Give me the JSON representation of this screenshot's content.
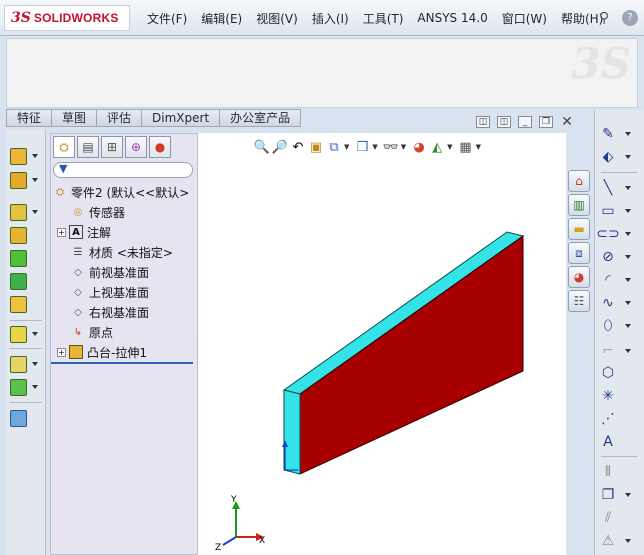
{
  "app": {
    "logo_prefix": "3S",
    "logo_text": "SOLIDWORKS"
  },
  "menu": {
    "items": [
      "文件(F)",
      "编辑(E)",
      "视图(V)",
      "插入(I)",
      "工具(T)",
      "ANSYS 14.0",
      "窗口(W)",
      "帮助(H)"
    ]
  },
  "command_manager": {
    "tabs": [
      "特征",
      "草图",
      "评估",
      "DimXpert",
      "办公室产品"
    ],
    "watermark": "3S"
  },
  "feature_tree": {
    "filter_icon": "filter-icon",
    "part": "零件2  (默认<<默认>",
    "items": [
      {
        "label": "传感器",
        "icon": "sensor-icon"
      },
      {
        "label": "注解",
        "icon": "annotation-icon",
        "expandable": true
      },
      {
        "label": "材质 <未指定>",
        "icon": "material-icon"
      },
      {
        "label": "前视基准面",
        "icon": "plane-icon"
      },
      {
        "label": "上视基准面",
        "icon": "plane-icon"
      },
      {
        "label": "右视基准面",
        "icon": "plane-icon"
      },
      {
        "label": "原点",
        "icon": "origin-icon"
      },
      {
        "label": "凸台-拉伸1",
        "icon": "extrude-icon",
        "expandable": true
      }
    ]
  },
  "graphics": {
    "triad": {
      "x": "X",
      "y": "Y",
      "z": "Z"
    },
    "colors": {
      "model_face": "#a80000",
      "model_edge": "#33e3e8",
      "background": "#ffffff"
    }
  }
}
